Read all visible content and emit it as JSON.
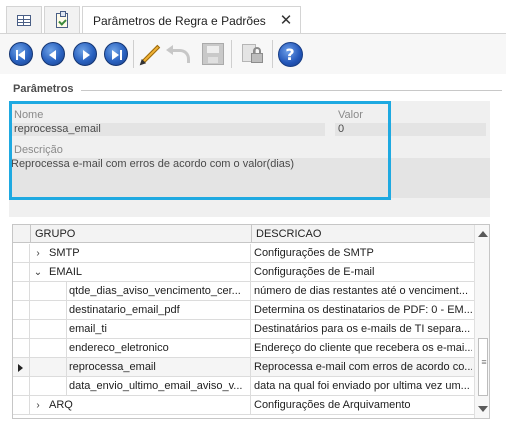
{
  "tabs": [
    {
      "icon": "grid-icon"
    },
    {
      "icon": "clipboard-check-icon"
    },
    {
      "label": "Parâmetros de Regra e Padrões",
      "close": "✕"
    }
  ],
  "toolbar": {
    "buttons": [
      "first-record-icon",
      "previous-record-icon",
      "next-record-icon",
      "last-record-icon",
      "edit-icon",
      "undo-icon",
      "save-icon",
      "lock-icon",
      "help-icon"
    ],
    "help_glyph": "?"
  },
  "params": {
    "section_title": "Parâmetros",
    "nome_label": "Nome",
    "nome_value": "reprocessa_email",
    "valor_label": "Valor",
    "valor_value": "0",
    "descricao_label": "Descrição",
    "descricao_value": "Reprocessa e-mail com erros de acordo com o valor(dias)"
  },
  "grid": {
    "columns": {
      "grupo": "GRUPO",
      "descricao": "DESCRICAO"
    },
    "rows": [
      {
        "level": 0,
        "expander": "›",
        "grupo": "SMTP",
        "descricao": "Configurações de SMTP"
      },
      {
        "level": 0,
        "expander": "⌄",
        "grupo": "EMAIL",
        "descricao": "Configurações de E-mail"
      },
      {
        "level": 1,
        "grupo": "qtde_dias_aviso_vencimento_cer...",
        "descricao": "número de dias restantes até o venciment..."
      },
      {
        "level": 1,
        "grupo": "destinatario_email_pdf",
        "descricao": "Determina os destinatarios de PDF: 0 - EM..."
      },
      {
        "level": 1,
        "grupo": "email_ti",
        "descricao": "Destinatários para os e-mails de TI separa..."
      },
      {
        "level": 1,
        "grupo": "endereco_eletronico",
        "descricao": "Endereço do cliente que recebera os e-mai..."
      },
      {
        "level": 1,
        "grupo": "reprocessa_email",
        "descricao": "Reprocessa e-mail com erros de acordo co...",
        "selected": true
      },
      {
        "level": 1,
        "grupo": "data_envio_ultimo_email_aviso_v...",
        "descricao": "data na qual foi enviado por ultima vez um..."
      },
      {
        "level": 0,
        "expander": "›",
        "grupo": "ARQ",
        "descricao": "Configurações de Arquivamento"
      }
    ]
  }
}
